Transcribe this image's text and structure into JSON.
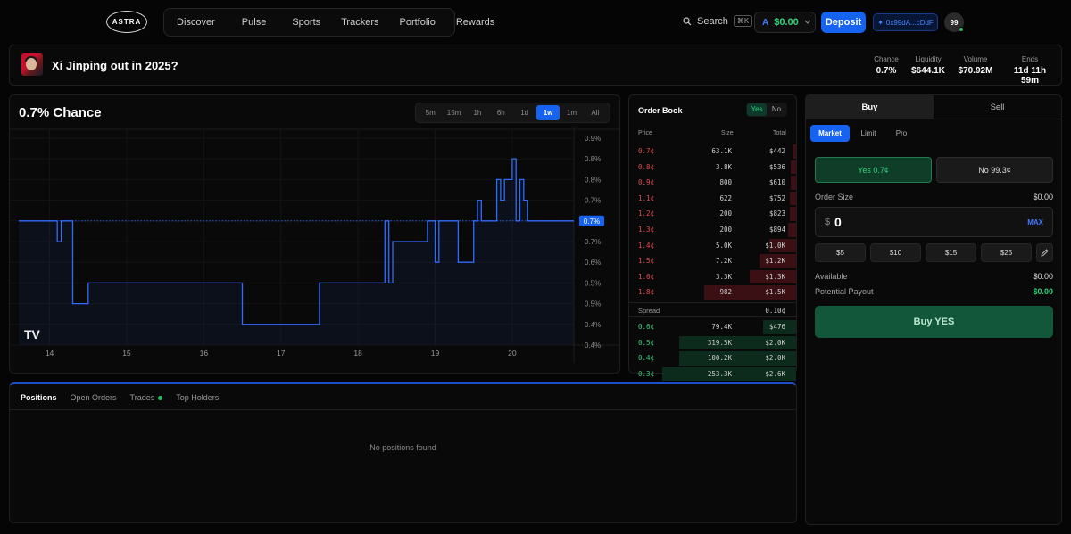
{
  "nav": {
    "logo": "ASTRA",
    "items": [
      "Discover",
      "Pulse",
      "Sports",
      "Trackers",
      "Portfolio",
      "Rewards"
    ],
    "search_label": "Search",
    "search_shortcut": "⌘K",
    "balance_icon": "A",
    "balance": "$0.00",
    "deposit": "Deposit",
    "wallet": "0x99dA...cDdF",
    "avatar": "99"
  },
  "market": {
    "title": "Xi Jinping out in 2025?",
    "stats": [
      {
        "label": "Chance",
        "value": "0.7%"
      },
      {
        "label": "Liquidity",
        "value": "$644.1K"
      },
      {
        "label": "Volume",
        "value": "$70.92M"
      },
      {
        "label": "Ends",
        "value": "11d 11h 59m"
      }
    ]
  },
  "chart": {
    "headline": "0.7% Chance",
    "ranges": [
      "5m",
      "15m",
      "1h",
      "6h",
      "1d",
      "1w",
      "1m",
      "All"
    ],
    "active_range": "1w",
    "watermark": "TV",
    "current_label": "0.7%"
  },
  "chart_data": {
    "type": "line",
    "x_ticks": [
      "14",
      "15",
      "16",
      "17",
      "18",
      "19",
      "20"
    ],
    "y_ticks": [
      "0.9%",
      "0.8%",
      "0.8%",
      "0.7%",
      "0.7%",
      "0.7%",
      "0.6%",
      "0.5%",
      "0.5%",
      "0.4%",
      "0.4%"
    ],
    "ylim": [
      0.4,
      0.9
    ],
    "series": [
      {
        "color": "#2f6bff",
        "x": [
          13.6,
          14.1,
          14.1,
          14.15,
          14.15,
          14.3,
          14.3,
          14.5,
          14.5,
          16.5,
          16.5,
          17.5,
          17.5,
          18.35,
          18.35,
          18.4,
          18.4,
          18.45,
          18.45,
          18.9,
          18.9,
          19.0,
          19.0,
          19.05,
          19.05,
          19.3,
          19.3,
          19.5,
          19.5,
          19.55,
          19.55,
          19.6,
          19.6,
          19.8,
          19.8,
          19.85,
          19.85,
          19.9,
          19.9,
          20.0,
          20.0,
          20.05,
          20.05,
          20.1,
          20.1,
          20.15,
          20.15,
          20.2,
          20.2,
          20.8
        ],
        "y": [
          0.7,
          0.7,
          0.65,
          0.65,
          0.7,
          0.7,
          0.5,
          0.5,
          0.55,
          0.55,
          0.45,
          0.45,
          0.55,
          0.55,
          0.7,
          0.7,
          0.55,
          0.55,
          0.65,
          0.65,
          0.7,
          0.7,
          0.6,
          0.6,
          0.7,
          0.7,
          0.6,
          0.6,
          0.7,
          0.7,
          0.75,
          0.75,
          0.7,
          0.7,
          0.8,
          0.8,
          0.75,
          0.75,
          0.8,
          0.8,
          0.85,
          0.85,
          0.7,
          0.7,
          0.8,
          0.8,
          0.75,
          0.75,
          0.7,
          0.7
        ]
      }
    ]
  },
  "orderbook": {
    "title": "Order Book",
    "toggle": [
      "Yes",
      "No"
    ],
    "headers": [
      "Price",
      "Size",
      "Total"
    ],
    "asks": [
      {
        "price": "0.7¢",
        "size": "63.1K",
        "total": "$442",
        "depth": 0.02
      },
      {
        "price": "0.8¢",
        "size": "3.8K",
        "total": "$536",
        "depth": 0.03
      },
      {
        "price": "0.9¢",
        "size": "800",
        "total": "$610",
        "depth": 0.03
      },
      {
        "price": "1.1¢",
        "size": "622",
        "total": "$752",
        "depth": 0.04
      },
      {
        "price": "1.2¢",
        "size": "200",
        "total": "$823",
        "depth": 0.04
      },
      {
        "price": "1.3¢",
        "size": "200",
        "total": "$894",
        "depth": 0.05
      },
      {
        "price": "1.4¢",
        "size": "5.0K",
        "total": "$1.0K",
        "depth": 0.16
      },
      {
        "price": "1.5¢",
        "size": "7.2K",
        "total": "$1.2K",
        "depth": 0.22
      },
      {
        "price": "1.6¢",
        "size": "3.3K",
        "total": "$1.3K",
        "depth": 0.28
      },
      {
        "price": "1.8¢",
        "size": "982",
        "total": "$1.5K",
        "depth": 0.55
      }
    ],
    "spread_label": "Spread",
    "spread_value": "0.10¢",
    "bids": [
      {
        "price": "0.6¢",
        "size": "79.4K",
        "total": "$476",
        "depth": 0.2
      },
      {
        "price": "0.5¢",
        "size": "319.5K",
        "total": "$2.0K",
        "depth": 0.7
      },
      {
        "price": "0.4¢",
        "size": "100.2K",
        "total": "$2.0K",
        "depth": 0.7
      },
      {
        "price": "0.3¢",
        "size": "253.3K",
        "total": "$2.6K",
        "depth": 0.8
      }
    ]
  },
  "trade": {
    "tabs": [
      "Buy",
      "Sell"
    ],
    "order_types": [
      "Market",
      "Limit",
      "Pro"
    ],
    "yes_label": "Yes 0.7¢",
    "no_label": "No 99.3¢",
    "order_size_label": "Order Size",
    "order_size_value": "$0.00",
    "currency": "$",
    "amount": "0",
    "max": "MAX",
    "quick_amounts": [
      "$5",
      "$10",
      "$15",
      "$25"
    ],
    "available_label": "Available",
    "available_value": "$0.00",
    "payout_label": "Potential Payout",
    "payout_value": "$0.00",
    "buy_button": "Buy YES"
  },
  "positions": {
    "tabs": [
      "Positions",
      "Open Orders",
      "Trades",
      "Top Holders"
    ],
    "empty": "No positions found"
  }
}
